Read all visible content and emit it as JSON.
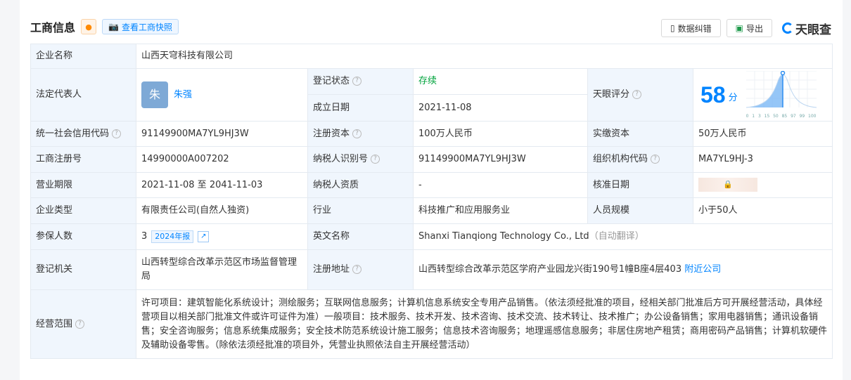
{
  "header": {
    "title": "工商信息",
    "snapshot_label": "查看工商快照",
    "correction_label": "数据纠错",
    "export_label": "导出",
    "logo_text": "天眼查"
  },
  "rows": {
    "company_name_label": "企业名称",
    "company_name": "山西天穹科技有限公司",
    "legal_rep_label": "法定代表人",
    "legal_rep_avatar": "朱",
    "legal_rep": "朱强",
    "status_label": "登记状态",
    "status": "存续",
    "founded_label": "成立日期",
    "founded": "2021-11-08",
    "score_label": "天眼评分",
    "score": "58",
    "score_unit": "分",
    "credit_code_label": "统一社会信用代码",
    "credit_code": "91149900MA7YL9HJ3W",
    "reg_capital_label": "注册资本",
    "reg_capital": "100万人民币",
    "paid_capital_label": "实缴资本",
    "paid_capital": "50万人民币",
    "reg_no_label": "工商注册号",
    "reg_no": "14990000A007202",
    "taxpayer_id_label": "纳税人识别号",
    "taxpayer_id": "91149900MA7YL9HJ3W",
    "org_code_label": "组织机构代码",
    "org_code": "MA7YL9HJ-3",
    "term_label": "营业期限",
    "term": "2021-11-08 至 2041-11-03",
    "taxpayer_qual_label": "纳税人资质",
    "taxpayer_qual": "-",
    "approval_date_label": "核准日期",
    "type_label": "企业类型",
    "type": "有限责任公司(自然人独资)",
    "industry_label": "行业",
    "industry": "科技推广和应用服务业",
    "staff_label": "人员规模",
    "staff": "小于50人",
    "insured_label": "参保人数",
    "insured": "3",
    "insured_report": "2024年报",
    "english_label": "英文名称",
    "english": "Shanxi Tianqiong Technology Co., Ltd",
    "english_note": "（自动翻译）",
    "authority_label": "登记机关",
    "authority": "山西转型综合改革示范区市场监督管理局",
    "address_label": "注册地址",
    "address": "山西转型综合改革示范区学府产业园龙兴街190号1幢B座4层403",
    "nearby": "附近公司",
    "scope_label": "经营范围",
    "scope": "许可项目：建筑智能化系统设计；测绘服务；互联网信息服务；计算机信息系统安全专用产品销售。（依法须经批准的项目，经相关部门批准后方可开展经营活动，具体经营项目以相关部门批准文件或许可证件为准）一般项目：技术服务、技术开发、技术咨询、技术交流、技术转让、技术推广；办公设备销售；家用电器销售；通讯设备销售；安全咨询服务；信息系统集成服务；安全技术防范系统设计施工服务；信息技术咨询服务；地理遥感信息服务；非居住房地产租赁；商用密码产品销售；计算机软硬件及辅助设备零售。（除依法须经批准的项目外，凭营业执照依法自主开展经营活动）"
  },
  "score_chart": {
    "ticks": [
      "0",
      "1",
      "3",
      "15",
      "50",
      "85",
      "97",
      "99",
      "100"
    ],
    "value": 58
  }
}
